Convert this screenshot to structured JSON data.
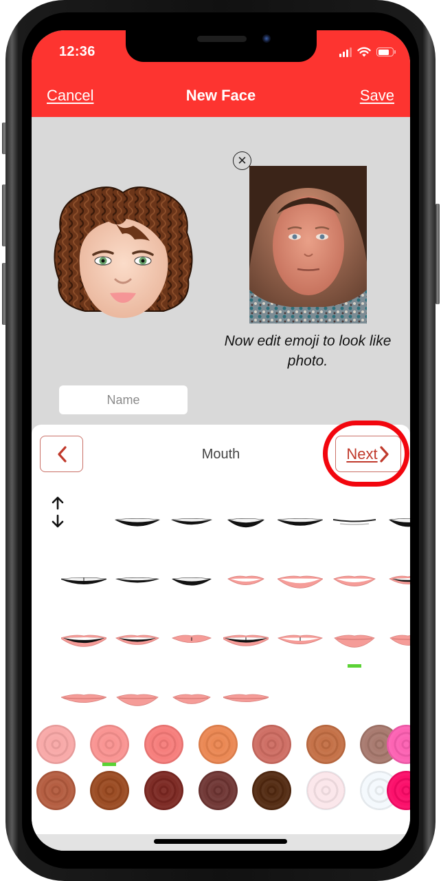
{
  "status_bar": {
    "time": "12:36",
    "icons": [
      "cellular-signal-icon",
      "wifi-icon",
      "battery-icon"
    ],
    "battery_level_fraction": 0.78
  },
  "nav": {
    "cancel_label": "Cancel",
    "title": "New Face",
    "save_label": "Save"
  },
  "colors": {
    "header_red": "#fd3430",
    "background_gray": "#d9d9d9",
    "button_outline": "#c96f66",
    "link_red": "#c0392b",
    "annotation_red": "#f2060e",
    "selection_green": "#5bd235"
  },
  "preview": {
    "emoji_avatar": "curly-brown-hair-green-eyes-avatar",
    "photo": "reference-selfie-photo",
    "close_icon": "close-circle-icon",
    "caption": "Now edit emoji to look like photo."
  },
  "name_field": {
    "value": "",
    "placeholder": "Name"
  },
  "editor": {
    "back_icon": "chevron-left-icon",
    "category_title": "Mouth",
    "next_label": "Next",
    "next_icon": "chevron-right-icon",
    "next_highlighted": true,
    "move_toggle_icon": "up-down-arrows-icon",
    "mouth_styles": [
      {
        "id": 1,
        "style": "open-dark-wide"
      },
      {
        "id": 2,
        "style": "open-dark-round"
      },
      {
        "id": 3,
        "style": "open-light-wide"
      },
      {
        "id": 4,
        "style": "smirk-dark"
      },
      {
        "id": 5,
        "style": "thin-line"
      },
      {
        "id": 6,
        "style": "small-light"
      },
      {
        "id": 7,
        "style": "dark-gap-teeth"
      },
      {
        "id": 8,
        "style": "dark-small-teeth"
      },
      {
        "id": 9,
        "style": "dark-big-teeth"
      },
      {
        "id": 10,
        "style": "pink-big-smile"
      },
      {
        "id": 11,
        "style": "pink-medium-smile"
      },
      {
        "id": 12,
        "style": "pink-small-smile"
      },
      {
        "id": 13,
        "style": "pink-open-grin"
      },
      {
        "id": 14,
        "style": "pink-teeth-grin"
      },
      {
        "id": 15,
        "style": "pink-wide-grin"
      },
      {
        "id": 16,
        "style": "pink-teeth-narrow"
      },
      {
        "id": 17,
        "style": "pink-gap-open"
      },
      {
        "id": 18,
        "style": "pink-gap-smile"
      },
      {
        "id": 19,
        "style": "pink-closed-smile",
        "selected": true
      },
      {
        "id": 20,
        "style": "pink-closed-wide"
      },
      {
        "id": 21,
        "style": "pink-thin-smile"
      },
      {
        "id": 22,
        "style": "pink-full-closed"
      },
      {
        "id": 23,
        "style": "pink-flat-closed"
      },
      {
        "id": 24,
        "style": "pink-pout"
      }
    ],
    "lip_colors": [
      {
        "hex": "#f8a7a6"
      },
      {
        "hex": "#f99290",
        "selected": true
      },
      {
        "hex": "#f67b79"
      },
      {
        "hex": "#ea8550"
      },
      {
        "hex": "#cd6b61"
      },
      {
        "hex": "#c36e43"
      },
      {
        "hex": "#a6776c"
      },
      {
        "hex": "#fc5fb1"
      },
      {
        "hex": "#b35a3d"
      },
      {
        "hex": "#99481f"
      },
      {
        "hex": "#7a2620"
      },
      {
        "hex": "#6d3432"
      },
      {
        "hex": "#51280f"
      },
      {
        "hex": "#fbe6ea"
      },
      {
        "hex": "#f4f9fd"
      },
      {
        "hex": "#fb0966"
      }
    ]
  }
}
